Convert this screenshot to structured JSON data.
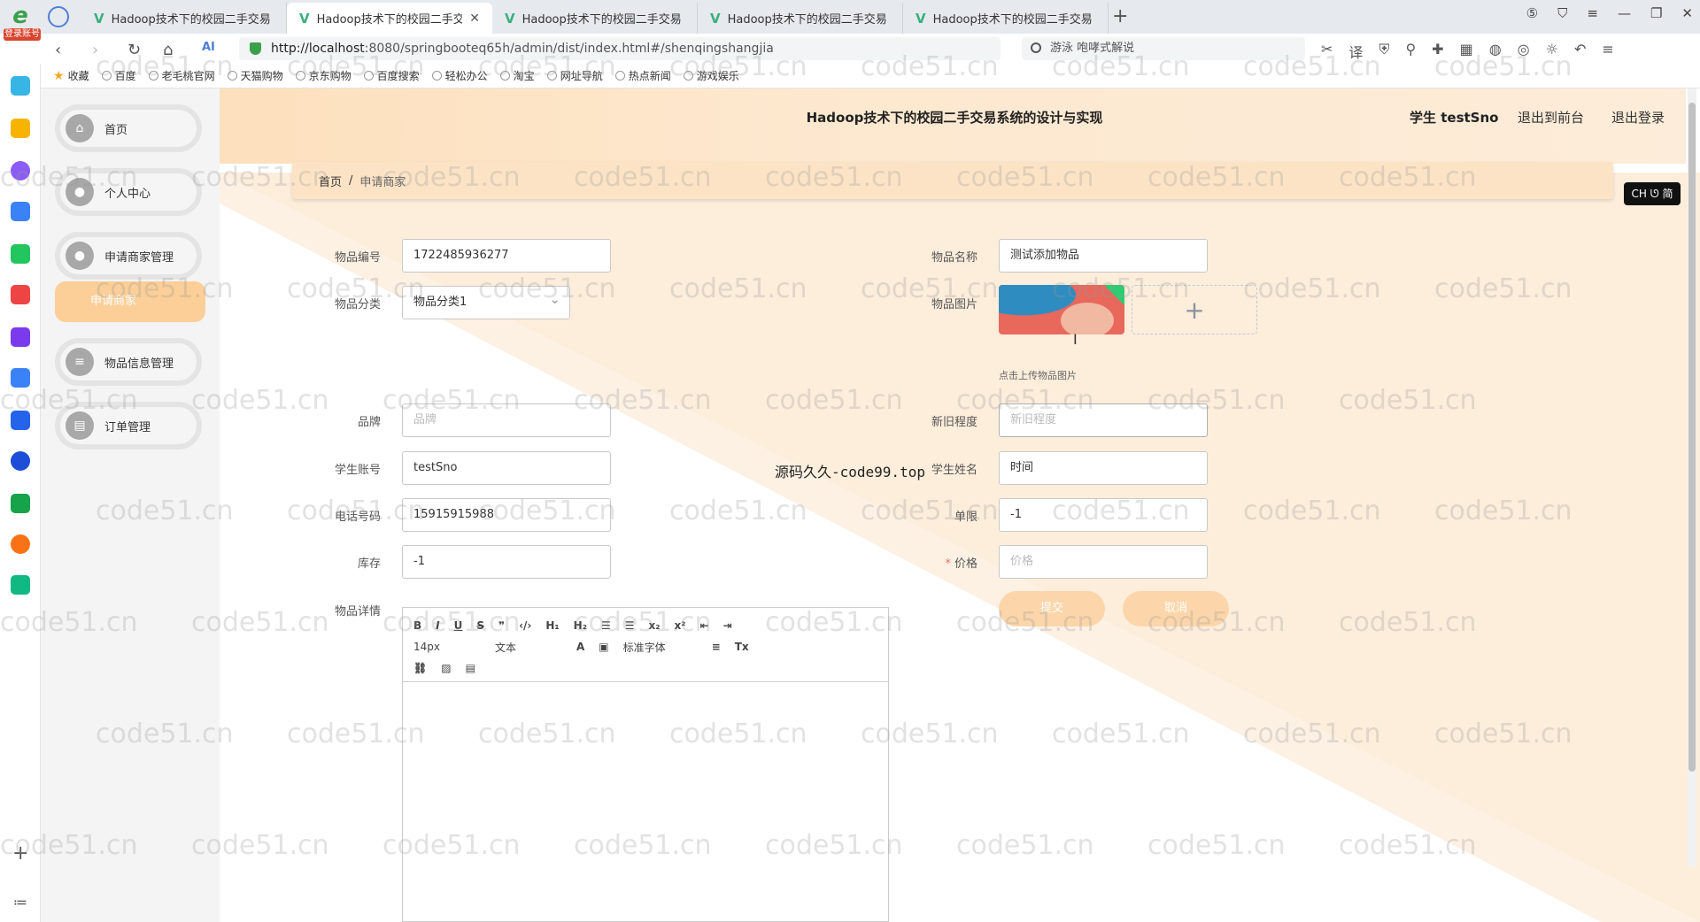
{
  "browser": {
    "badge": "登录账号",
    "tabs": [
      {
        "label": "Hadoop技术下的校园二手交易",
        "active": false
      },
      {
        "label": "Hadoop技术下的校园二手交易",
        "active": true
      },
      {
        "label": "Hadoop技术下的校园二手交易",
        "active": false
      },
      {
        "label": "Hadoop技术下的校园二手交易",
        "active": false
      },
      {
        "label": "Hadoop技术下的校园二手交易",
        "active": false
      }
    ],
    "url_host": "http://localhost",
    "url_rest": ":8080/springbooteq65h/admin/dist/index.html#/shenqingshangjia",
    "search_text": "游泳 咆哮式解说",
    "bookmarks": [
      "收藏",
      "百度",
      "老毛桃官网",
      "天猫购物",
      "京东购物",
      "百度搜索",
      "轻松办公",
      "淘宝",
      "网址导航",
      "热点新闻",
      "游戏娱乐"
    ]
  },
  "header": {
    "title": "Hadoop技术下的校园二手交易系统的设计与实现",
    "user": "学生 testSno",
    "front_link": "退出到前台",
    "logout_link": "退出登录"
  },
  "sidebar": {
    "items": [
      {
        "label": "首页",
        "icon": "home-icon"
      },
      {
        "label": "个人中心",
        "icon": "user-icon"
      },
      {
        "label": "申请商家管理",
        "icon": "user-icon"
      },
      {
        "label": "物品信息管理",
        "icon": "list-icon"
      },
      {
        "label": "订单管理",
        "icon": "clipboard-icon"
      }
    ],
    "submenu_label": "申请商家"
  },
  "breadcrumb": {
    "home": "首页",
    "sep": "/",
    "current": "申请商家"
  },
  "ime_badge": "CH ᘎ 简",
  "form": {
    "item_no": {
      "label": "物品编号",
      "value": "1722485936277"
    },
    "item_name": {
      "label": "物品名称",
      "value": "测试添加物品"
    },
    "category": {
      "label": "物品分类",
      "value": "物品分类1"
    },
    "image": {
      "label": "物品图片",
      "hint": "点击上传物品图片"
    },
    "brand": {
      "label": "品牌",
      "placeholder": "品牌"
    },
    "condition": {
      "label": "新旧程度",
      "placeholder": "新旧程度"
    },
    "student_account": {
      "label": "学生账号",
      "value": "testSno"
    },
    "student_name": {
      "label": "学生姓名",
      "value": "时间"
    },
    "phone": {
      "label": "电话号码",
      "value": "15915915988"
    },
    "limit": {
      "label": "单限",
      "value": "-1"
    },
    "stock": {
      "label": "库存",
      "value": "-1"
    },
    "price": {
      "label": "价格",
      "placeholder": "价格"
    },
    "detail": {
      "label": "物品详情"
    },
    "submit": "提交",
    "cancel": "取消"
  },
  "editor": {
    "font_size": "14px",
    "paragraph": "文本",
    "font_family": "标准字体"
  },
  "overlay_text": "源码久久-code99.top",
  "watermark": "code51.cn"
}
